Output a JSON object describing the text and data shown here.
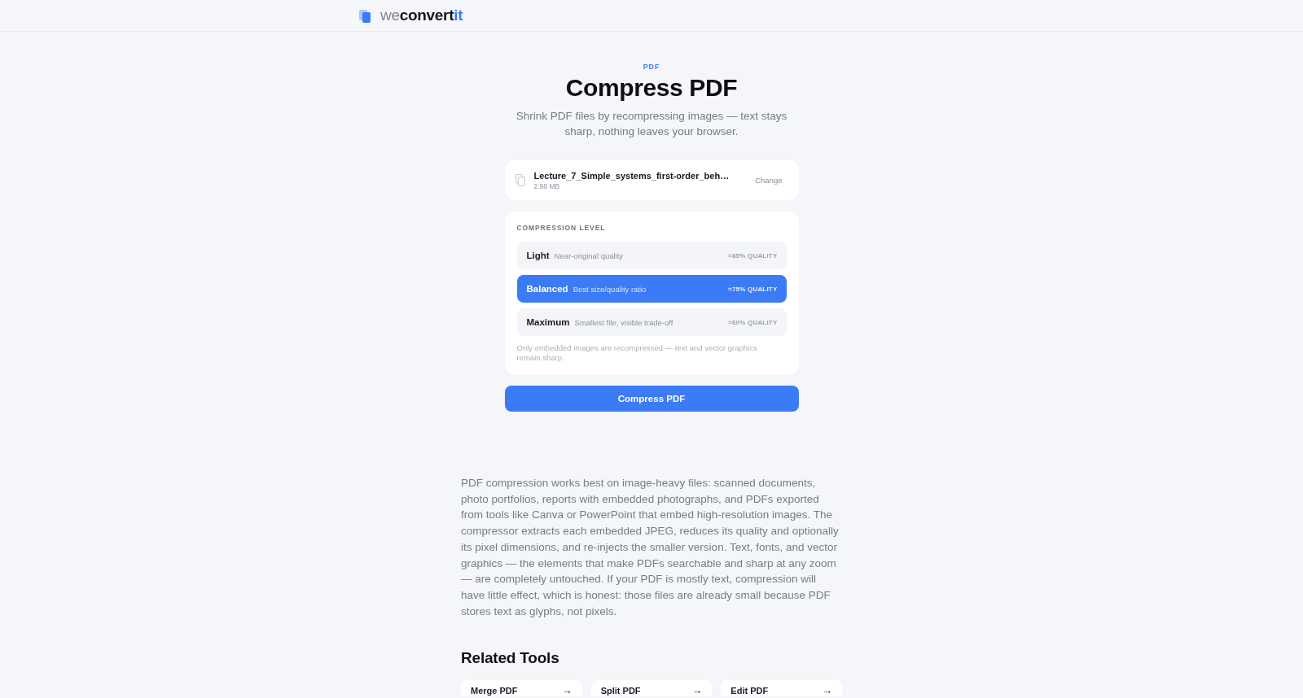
{
  "header": {
    "logo": {
      "parts": [
        {
          "text": "we",
          "kind": "light"
        },
        {
          "text": "convert",
          "kind": "strong"
        },
        {
          "text": "it",
          "kind": "accent"
        }
      ]
    }
  },
  "hero": {
    "eyebrow": "PDF",
    "title": "Compress PDF",
    "subtitle": "Shrink PDF files by recompressing images — text stays sharp, nothing leaves your browser."
  },
  "file": {
    "name": "Lecture_7_Simple_systems_first-order_beh…",
    "size": "2.98 MB",
    "action": "Change"
  },
  "compression": {
    "label": "COMPRESSION LEVEL",
    "options": [
      {
        "name": "Light",
        "description": "Near-original quality",
        "quality": "≈85% QUALITY",
        "selected": false
      },
      {
        "name": "Balanced",
        "description": "Best size/quality ratio",
        "quality": "≈75% QUALITY",
        "selected": true
      },
      {
        "name": "Maximum",
        "description": "Smallest file, visible trade-off",
        "quality": "≈60% QUALITY",
        "selected": false
      }
    ],
    "note": "Only embedded images are recompressed — text and vector graphics remain sharp."
  },
  "submit": {
    "label": "Compress PDF"
  },
  "article": {
    "text": "PDF compression works best on image-heavy files: scanned documents, photo portfolios, reports with embedded photographs, and PDFs exported from tools like Canva or PowerPoint that embed high-resolution images. The compressor extracts each embedded JPEG, reduces its quality and optionally its pixel dimensions, and re-injects the smaller version. Text, fonts, and vector graphics — the elements that make PDFs searchable and sharp at any zoom — are completely untouched. If your PDF is mostly text, compression will have little effect, which is honest: those files are already small because PDF stores text as glyphs, not pixels."
  },
  "related": {
    "title": "Related Tools",
    "tools": [
      {
        "label": "Merge PDF",
        "arrow": "→"
      },
      {
        "label": "Split PDF",
        "arrow": "→"
      },
      {
        "label": "Edit PDF",
        "arrow": "→"
      }
    ]
  }
}
